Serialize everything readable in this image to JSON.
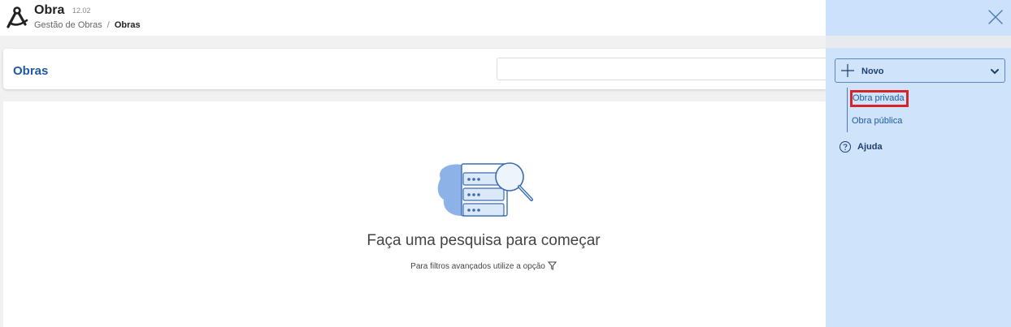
{
  "app": {
    "title": "Obra",
    "version": "12.02",
    "breadcrumb": {
      "parent": "Gestão de Obras",
      "separator": "/",
      "current": "Obras"
    }
  },
  "page": {
    "title": "Obras",
    "search": {
      "value": "",
      "placeholder": ""
    }
  },
  "empty_state": {
    "title": "Faça uma pesquisa para começar",
    "hint": "Para filtros avançados utilize a opção"
  },
  "side_panel": {
    "new_button_label": "Novo",
    "menu": [
      {
        "label": "Obra privada",
        "highlighted": true
      },
      {
        "label": "Obra pública",
        "highlighted": false
      }
    ],
    "help_label": "Ajuda"
  },
  "icons": {
    "logo": "compass-icon",
    "close": "close-icon",
    "plus": "plus-icon",
    "chevron": "chevron-down-icon",
    "help": "help-circle-icon",
    "filter": "filter-icon",
    "illustration": "database-search-icon"
  },
  "colors": {
    "accent": "#1e5aa0",
    "panel": "#cfe4fb",
    "highlight_border": "#d8232a"
  }
}
